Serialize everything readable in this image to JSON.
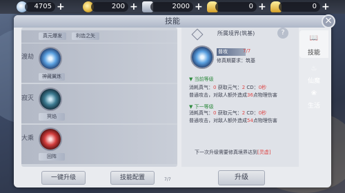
{
  "currency": {
    "silver_moon": "4705",
    "gold": "200",
    "silver_bar": "2000",
    "ingot_a": "0",
    "ingot_b": "0"
  },
  "panel": {
    "title": "技能"
  },
  "left": {
    "labels": [
      "渡劫",
      "寂灭",
      "大乘"
    ],
    "top_tags": [
      "真元爆发",
      "利齿之矢"
    ],
    "skills": [
      "神藏翼炼",
      "冥焰",
      "回阵"
    ]
  },
  "right": {
    "realm_label": "所属境界(筑基)",
    "realm_help": "?",
    "skill_name": "普攻",
    "skill_level": "7/7",
    "requirement": "修真期要求：筑基",
    "current_title": "▼ 当前等级",
    "current_line1_a": "消耗真气：",
    "current_line1_b": "0",
    "current_line1_c": "  获取元气：",
    "current_line1_d": "2",
    "current_line1_e": "  CD：",
    "current_line1_f": "0秒",
    "current_line2_a": "普通攻击，对敌人额外造成",
    "current_line2_b": "36",
    "current_line2_c": "点物理伤害",
    "next_title": "▼ 下一等级",
    "next_line1_a": "消耗真气：",
    "next_line1_b": "0",
    "next_line1_c": "  获取元气：",
    "next_line1_d": "2",
    "next_line1_e": "  CD：",
    "next_line1_f": "0秒",
    "next_line2_a": "普通攻击，对敌人额外造成",
    "next_line2_b": "54",
    "next_line2_c": "点物理伤害",
    "next_upgrade": "下一次升级需要修真境界达到",
    "next_upgrade_realm": "[灵虚]"
  },
  "tabs": [
    "技能",
    "仙魔",
    "生活"
  ],
  "buttons": {
    "one_click": "一键升级",
    "config": "技能配置",
    "upgrade": "升级"
  },
  "page_indicator": "7/7"
}
